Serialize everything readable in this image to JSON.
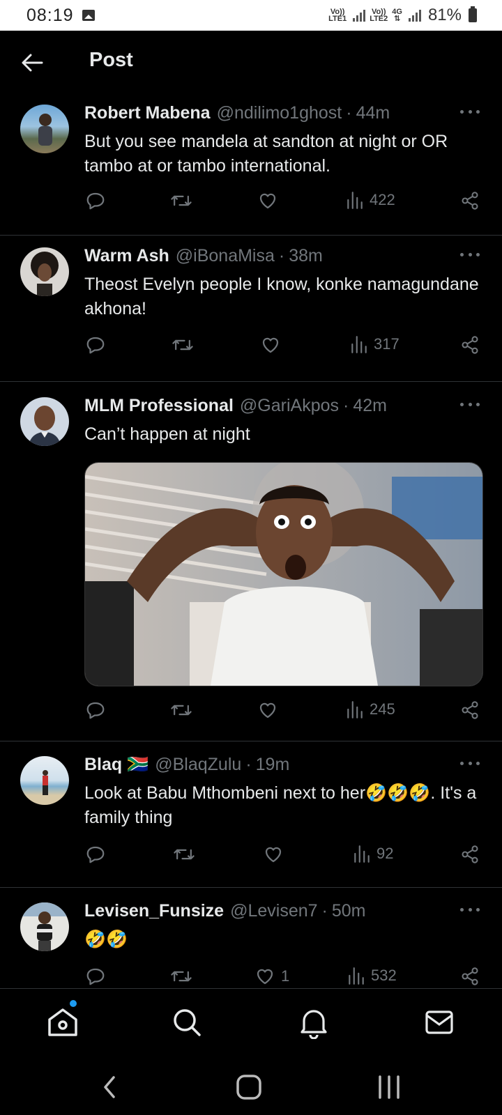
{
  "status_bar": {
    "time": "08:19",
    "sim1": {
      "top": "Vo))",
      "bottom": "LTE1"
    },
    "sim2": {
      "top": "Vo))",
      "bottom": "LTE2"
    },
    "network": "4G",
    "battery": "81%"
  },
  "header": {
    "title": "Post"
  },
  "tweets": [
    {
      "name": "Robert Mabena",
      "handle": "@ndilimo1ghost",
      "time": "44m",
      "text": "But you see mandela at sandton at night or OR tambo  at or tambo international.",
      "views": "422",
      "likes": ""
    },
    {
      "name": "Warm Ash",
      "handle": "@iBonaMisa",
      "time": "38m",
      "text": "Theost Evelyn people I know, konke namagundane akhona!",
      "views": "317",
      "likes": ""
    },
    {
      "name": "MLM Professional",
      "handle": "@GariAkpos",
      "time": "42m",
      "text": "Can’t happen at night",
      "views": "245",
      "likes": ""
    },
    {
      "name": "Blaq 🇿🇦",
      "handle": "@BlaqZulu",
      "time": "19m",
      "text": "Look at Babu Mthombeni next to her🤣🤣🤣. It's a family thing",
      "views": "92",
      "likes": ""
    },
    {
      "name": "Levisen_Funsize",
      "handle": "@Levisen7",
      "time": "50m",
      "text": "🤣🤣",
      "views": "532",
      "likes": "1"
    }
  ],
  "colors": {
    "background": "#000000",
    "text": "#e7e9ea",
    "muted": "#71767b",
    "accent": "#1d9bf0",
    "divider": "#2f3336"
  },
  "icons": {
    "reply": "reply-icon",
    "retweet": "retweet-icon",
    "like": "heart-icon",
    "views": "views-icon",
    "share": "share-icon"
  }
}
